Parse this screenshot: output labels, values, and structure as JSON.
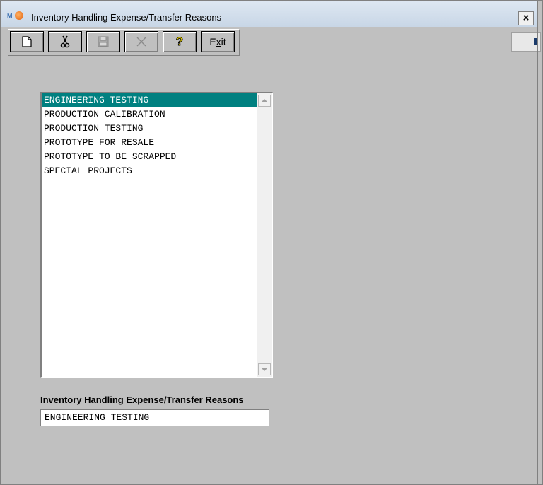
{
  "window": {
    "title": "Inventory Handling Expense/Transfer Reasons",
    "app_icon": "mx-logo-icon",
    "close_label": "×"
  },
  "toolbar": {
    "buttons": [
      {
        "name": "new-button",
        "icon": "new-document-icon"
      },
      {
        "name": "cut-button",
        "icon": "scissors-icon"
      },
      {
        "name": "save-button",
        "icon": "floppy-disk-icon",
        "disabled": true
      },
      {
        "name": "delete-button",
        "icon": "x-mark-icon",
        "disabled": true
      },
      {
        "name": "help-button",
        "icon": "question-mark-icon"
      },
      {
        "name": "exit-button",
        "label_prefix": "E",
        "label_accel": "x",
        "label_suffix": "it"
      }
    ]
  },
  "reasons_list": {
    "items": [
      "ENGINEERING TESTING",
      "PRODUCTION CALIBRATION",
      "PRODUCTION TESTING",
      "PROTOTYPE FOR RESALE",
      "PROTOTYPE TO BE SCRAPPED",
      "SPECIAL PROJECTS"
    ],
    "selected_index": 0
  },
  "detail": {
    "label": "Inventory Handling Expense/Transfer Reasons",
    "value": "ENGINEERING TESTING"
  },
  "colors": {
    "selection": "#008080",
    "background": "#c0c0c0"
  }
}
